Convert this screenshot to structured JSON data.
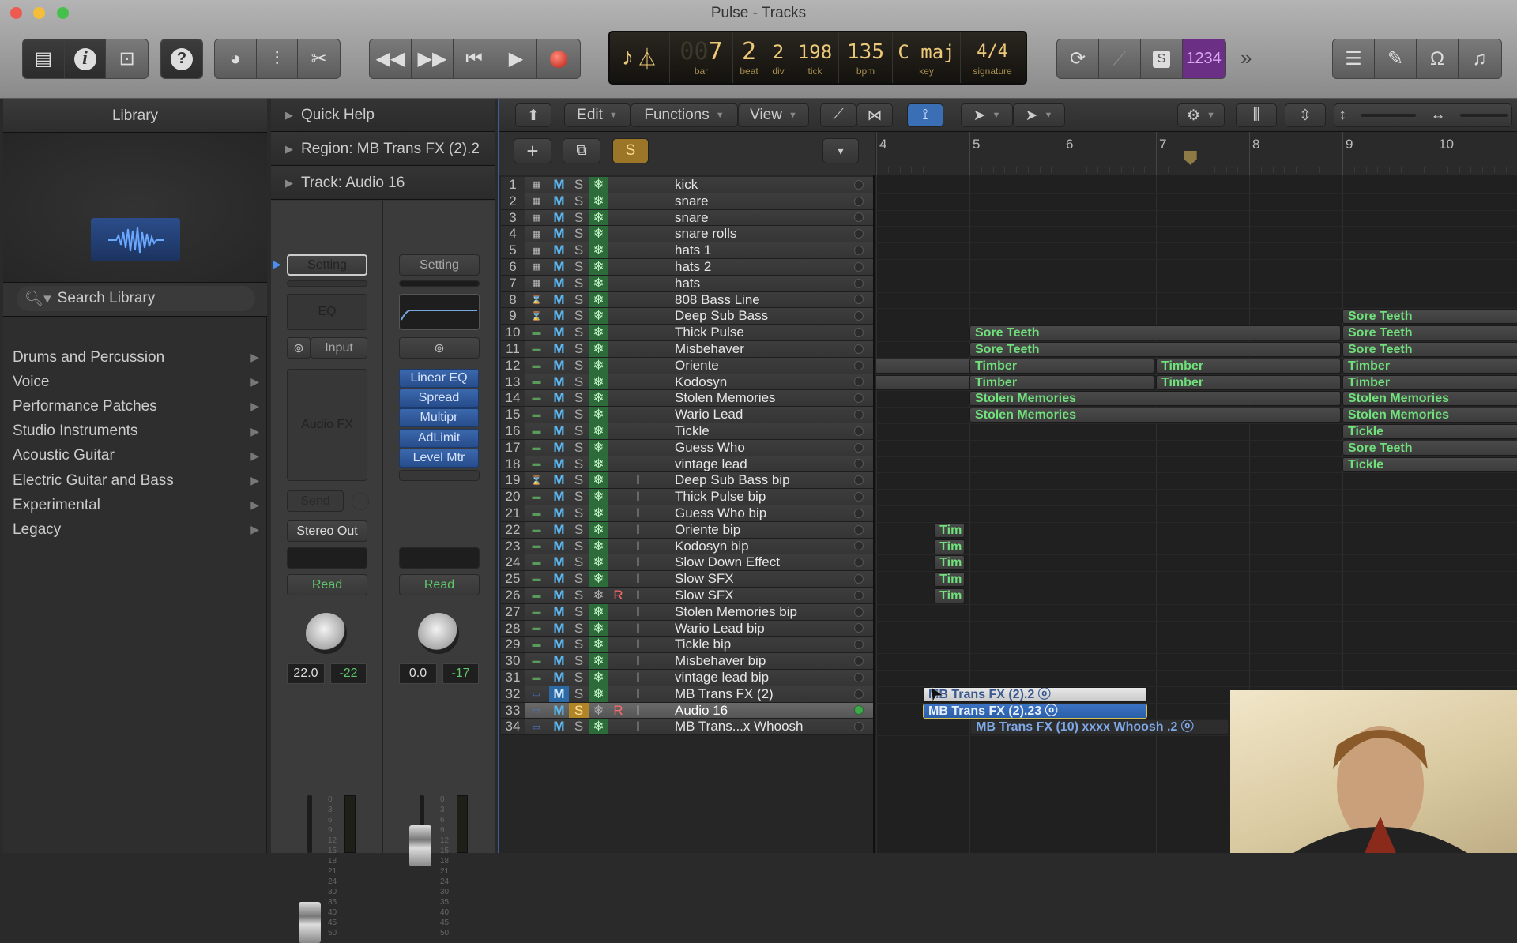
{
  "window": {
    "title": "Pulse - Tracks"
  },
  "toolbar": {
    "view_buttons": [
      "library-icon",
      "inspector-icon",
      "toolbar-icon"
    ],
    "help_icon": "quick-help-icon",
    "tool_buttons": [
      "smart-controls-icon",
      "mixer-icon",
      "editors-icon"
    ],
    "transport": [
      "rewind-icon",
      "fast-forward-icon",
      "go-to-beginning-icon",
      "play-icon",
      "record-icon"
    ],
    "lcd": {
      "bar": "7",
      "bar_prefix": "00",
      "beat": "2",
      "div": "2",
      "tick": "198",
      "bpm": "135",
      "key": "C maj",
      "signature": "4/4",
      "labels": {
        "bar": "bar",
        "beat": "beat",
        "div": "div",
        "tick": "tick",
        "bpm": "bpm",
        "key": "key",
        "signature": "signature"
      }
    },
    "mode_buttons": {
      "cycle": "cycle-icon",
      "tuner": "tuner-icon",
      "solo": "S",
      "count_in": "1234"
    },
    "more": "»",
    "right_buttons": [
      "list-editors-icon",
      "notepad-icon",
      "loop-browser-icon",
      "media-browser-icon"
    ]
  },
  "library": {
    "header": "Library",
    "search_placeholder": "Search Library",
    "categories": [
      "Drums and Percussion",
      "Voice",
      "Performance Patches",
      "Studio Instruments",
      "Acoustic Guitar",
      "Electric Guitar and Bass",
      "Experimental",
      "Legacy"
    ]
  },
  "inspector": {
    "quick_help": "Quick Help",
    "region": "Region: MB Trans FX (2).2",
    "track": "Track:  Audio 16",
    "strip1": {
      "setting": "Setting",
      "eq": "EQ",
      "input": "Input",
      "audio_fx": "Audio FX",
      "send": "Send",
      "output": "Stereo Out",
      "automation": "Read",
      "volume": "22.0",
      "peak": "-22"
    },
    "strip2": {
      "setting": "Setting",
      "plugins": [
        "Linear EQ",
        "Spread",
        "Multipr",
        "AdLimit",
        "Level Mtr"
      ],
      "automation": "Read",
      "volume": "0.0",
      "peak": "-17"
    },
    "meter_scale": [
      "0",
      "3",
      "6",
      "9",
      "12",
      "15",
      "18",
      "21",
      "24",
      "30",
      "35",
      "40",
      "45",
      "50"
    ]
  },
  "tracks_area": {
    "menus": {
      "edit": "Edit",
      "functions": "Functions",
      "view": "View"
    },
    "header_buttons": {
      "add": "+",
      "solo": "S"
    },
    "ruler": [
      "4",
      "5",
      "6",
      "7",
      "8",
      "9",
      "10"
    ],
    "playhead_bar": 7.37,
    "tracks": [
      {
        "n": "1",
        "name": "kick",
        "icon": "drum",
        "m": false,
        "s": false,
        "frz": true,
        "r": "",
        "i": false,
        "led": false
      },
      {
        "n": "2",
        "name": "snare",
        "icon": "drum",
        "m": false,
        "s": false,
        "frz": true,
        "r": "",
        "i": false,
        "led": false
      },
      {
        "n": "3",
        "name": "snare",
        "icon": "drum",
        "m": false,
        "s": false,
        "frz": true,
        "r": "",
        "i": false,
        "led": false
      },
      {
        "n": "4",
        "name": "snare rolls",
        "icon": "drum",
        "m": false,
        "s": false,
        "frz": true,
        "r": "",
        "i": false,
        "led": false
      },
      {
        "n": "5",
        "name": "hats 1",
        "icon": "drum",
        "m": false,
        "s": false,
        "frz": true,
        "r": "",
        "i": false,
        "led": false
      },
      {
        "n": "6",
        "name": "hats 2",
        "icon": "drum",
        "m": false,
        "s": false,
        "frz": true,
        "r": "",
        "i": false,
        "led": false
      },
      {
        "n": "7",
        "name": "hats",
        "icon": "drum",
        "m": false,
        "s": false,
        "frz": true,
        "r": "",
        "i": false,
        "led": false
      },
      {
        "n": "8",
        "name": "808 Bass Line",
        "icon": "synth",
        "m": false,
        "s": false,
        "frz": true,
        "r": "",
        "i": false,
        "led": false
      },
      {
        "n": "9",
        "name": "Deep Sub Bass",
        "icon": "synth",
        "m": false,
        "s": false,
        "frz": true,
        "r": "",
        "i": false,
        "led": false
      },
      {
        "n": "10",
        "name": "Thick Pulse",
        "icon": "keys",
        "m": false,
        "s": false,
        "frz": true,
        "r": "",
        "i": false,
        "led": false
      },
      {
        "n": "11",
        "name": "Misbehaver",
        "icon": "keys",
        "m": false,
        "s": false,
        "frz": true,
        "r": "",
        "i": false,
        "led": false
      },
      {
        "n": "12",
        "name": "Oriente",
        "icon": "keys",
        "m": false,
        "s": false,
        "frz": true,
        "r": "",
        "i": false,
        "led": false
      },
      {
        "n": "13",
        "name": "Kodosyn",
        "icon": "keys",
        "m": false,
        "s": false,
        "frz": true,
        "r": "",
        "i": false,
        "led": false
      },
      {
        "n": "14",
        "name": "Stolen Memories",
        "icon": "keys",
        "m": false,
        "s": false,
        "frz": true,
        "r": "",
        "i": false,
        "led": false
      },
      {
        "n": "15",
        "name": "Wario Lead",
        "icon": "keys",
        "m": false,
        "s": false,
        "frz": true,
        "r": "",
        "i": false,
        "led": false
      },
      {
        "n": "16",
        "name": "Tickle",
        "icon": "keys",
        "m": false,
        "s": false,
        "frz": true,
        "r": "",
        "i": false,
        "led": false
      },
      {
        "n": "17",
        "name": "Guess Who",
        "icon": "keys",
        "m": false,
        "s": false,
        "frz": true,
        "r": "",
        "i": false,
        "led": false
      },
      {
        "n": "18",
        "name": "vintage lead",
        "icon": "keys",
        "m": false,
        "s": false,
        "frz": true,
        "r": "",
        "i": false,
        "led": false
      },
      {
        "n": "19",
        "name": "Deep Sub Bass  bip",
        "icon": "synth",
        "m": false,
        "s": false,
        "frz": true,
        "r": "",
        "i": true,
        "led": false
      },
      {
        "n": "20",
        "name": "Thick Pulse  bip",
        "icon": "keys",
        "m": false,
        "s": false,
        "frz": true,
        "r": "",
        "i": true,
        "led": false
      },
      {
        "n": "21",
        "name": "Guess Who  bip",
        "icon": "keys",
        "m": false,
        "s": false,
        "frz": true,
        "r": "",
        "i": true,
        "led": false
      },
      {
        "n": "22",
        "name": "Oriente  bip",
        "icon": "keys",
        "m": false,
        "s": false,
        "frz": true,
        "r": "",
        "i": true,
        "led": false
      },
      {
        "n": "23",
        "name": "Kodosyn  bip",
        "icon": "keys",
        "m": false,
        "s": false,
        "frz": true,
        "r": "",
        "i": true,
        "led": false
      },
      {
        "n": "24",
        "name": "Slow Down Effect",
        "icon": "keys",
        "m": false,
        "s": false,
        "frz": true,
        "r": "",
        "i": true,
        "led": false
      },
      {
        "n": "25",
        "name": "Slow SFX",
        "icon": "keys",
        "m": false,
        "s": false,
        "frz": true,
        "r": "",
        "i": true,
        "led": false
      },
      {
        "n": "26",
        "name": "Slow SFX",
        "icon": "keys",
        "m": false,
        "s": false,
        "frz": false,
        "r": "R",
        "i": true,
        "led": false
      },
      {
        "n": "27",
        "name": "Stolen Memories  bip",
        "icon": "keys",
        "m": false,
        "s": false,
        "frz": true,
        "r": "",
        "i": true,
        "led": false
      },
      {
        "n": "28",
        "name": "Wario Lead  bip",
        "icon": "keys",
        "m": false,
        "s": false,
        "frz": true,
        "r": "",
        "i": true,
        "led": false
      },
      {
        "n": "29",
        "name": "Tickle  bip",
        "icon": "keys",
        "m": false,
        "s": false,
        "frz": true,
        "r": "",
        "i": true,
        "led": false
      },
      {
        "n": "30",
        "name": "Misbehaver  bip",
        "icon": "keys",
        "m": false,
        "s": false,
        "frz": true,
        "r": "",
        "i": true,
        "led": false
      },
      {
        "n": "31",
        "name": "vintage lead  bip",
        "icon": "keys",
        "m": false,
        "s": false,
        "frz": true,
        "r": "",
        "i": true,
        "led": false
      },
      {
        "n": "32",
        "name": "MB Trans FX (2)",
        "icon": "audio",
        "m": true,
        "s": false,
        "frz": true,
        "r": "",
        "i": true,
        "led": false
      },
      {
        "n": "33",
        "name": "Audio 16",
        "icon": "audio",
        "m": false,
        "s": true,
        "frz": false,
        "r": "R",
        "i": true,
        "led": true,
        "selected": true
      },
      {
        "n": "34",
        "name": "MB Trans...x Whoosh",
        "icon": "audio",
        "m": false,
        "s": false,
        "frz": true,
        "r": "",
        "i": true,
        "led": false
      }
    ],
    "regions": [
      {
        "track": 9,
        "start": 9,
        "end": 11,
        "label": "Sore Teeth",
        "kind": "midi"
      },
      {
        "track": 10,
        "start": 5,
        "end": 9,
        "label": "Sore Teeth",
        "kind": "midi"
      },
      {
        "track": 10,
        "start": 9,
        "end": 11,
        "label": "Sore Teeth",
        "kind": "midi"
      },
      {
        "track": 11,
        "start": 5,
        "end": 9,
        "label": "Sore Teeth",
        "kind": "midi"
      },
      {
        "track": 11,
        "start": 9,
        "end": 11,
        "label": "Sore Teeth",
        "kind": "midi"
      },
      {
        "track": 12,
        "start": 3,
        "end": 4.74,
        "label": "",
        "kind": "midi"
      },
      {
        "track": 12,
        "start": 5,
        "end": 7,
        "label": "Timber",
        "kind": "midi"
      },
      {
        "track": 12,
        "start": 7,
        "end": 9,
        "label": "Timber",
        "kind": "midi"
      },
      {
        "track": 12,
        "start": 9,
        "end": 11,
        "label": "Timber",
        "kind": "midi"
      },
      {
        "track": 13,
        "start": 3,
        "end": 4.74,
        "label": "",
        "kind": "midi"
      },
      {
        "track": 13,
        "start": 5,
        "end": 7,
        "label": "Timber",
        "kind": "midi"
      },
      {
        "track": 13,
        "start": 7,
        "end": 9,
        "label": "Timber",
        "kind": "midi"
      },
      {
        "track": 13,
        "start": 9,
        "end": 11,
        "label": "Timber",
        "kind": "midi"
      },
      {
        "track": 14,
        "start": 5,
        "end": 9,
        "label": "Stolen Memories",
        "kind": "midi"
      },
      {
        "track": 14,
        "start": 9,
        "end": 11,
        "label": "Stolen Memories",
        "kind": "midi"
      },
      {
        "track": 15,
        "start": 5,
        "end": 9,
        "label": "Stolen Memories",
        "kind": "midi"
      },
      {
        "track": 15,
        "start": 9,
        "end": 11,
        "label": "Stolen Memories",
        "kind": "midi"
      },
      {
        "track": 16,
        "start": 9,
        "end": 11,
        "label": "Tickle",
        "kind": "midi"
      },
      {
        "track": 17,
        "start": 9,
        "end": 11,
        "label": "Tickle",
        "kind": "midi",
        "display": "Sore Teeth"
      },
      {
        "track": 18,
        "start": 9,
        "end": 11,
        "label": "Tickle",
        "kind": "midi"
      },
      {
        "track": 22,
        "start": 4.62,
        "end": 4.97,
        "label": "Tim",
        "kind": "midi"
      },
      {
        "track": 23,
        "start": 4.62,
        "end": 4.97,
        "label": "Tim",
        "kind": "midi"
      },
      {
        "track": 24,
        "start": 4.62,
        "end": 4.97,
        "label": "Tim",
        "kind": "midi"
      },
      {
        "track": 25,
        "start": 4.62,
        "end": 4.97,
        "label": "Tim",
        "kind": "midi"
      },
      {
        "track": 26,
        "start": 4.62,
        "end": 4.97,
        "label": "Tim",
        "kind": "midi"
      },
      {
        "track": 32,
        "start": 4.5,
        "end": 6.92,
        "label": "MB Trans FX (2).2  ⓞ",
        "kind": "audio-light"
      },
      {
        "track": 33,
        "start": 4.5,
        "end": 6.92,
        "label": "MB Trans FX (2).23  ⓞ",
        "kind": "audio-sel"
      },
      {
        "track": 34,
        "start": 5.01,
        "end": 7.8,
        "label": "MB Trans FX (10) xxxx Whoosh .2  ⓞ",
        "kind": "audio"
      }
    ]
  }
}
